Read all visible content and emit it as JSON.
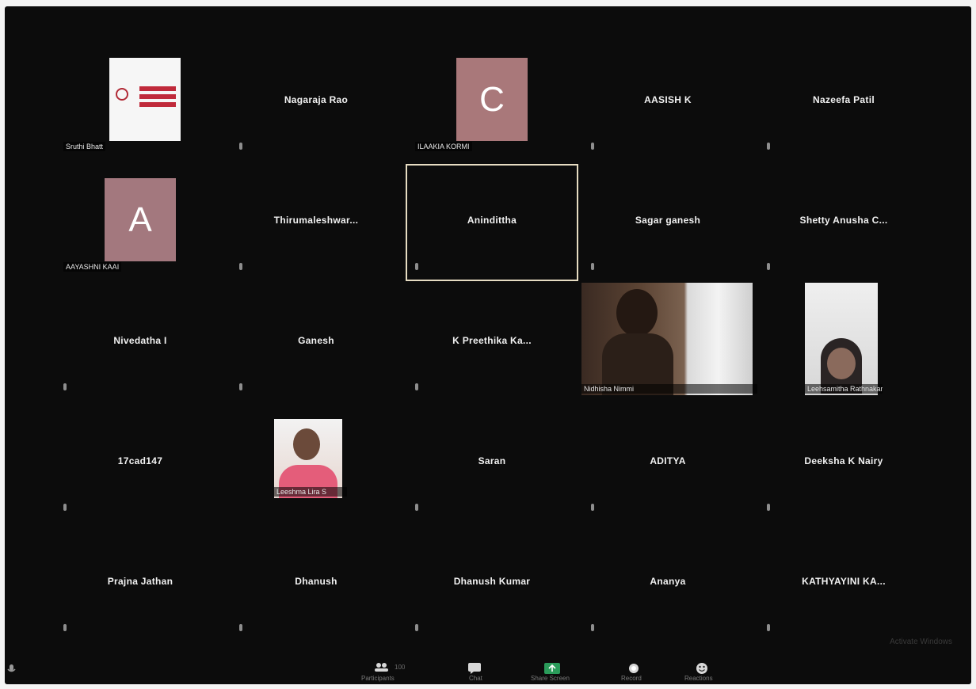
{
  "participants": [
    {
      "name": "",
      "caption": "Sruthi Bhatt",
      "kind": "logo"
    },
    {
      "name": "Nagaraja Rao",
      "caption": "",
      "kind": "name"
    },
    {
      "name": "",
      "caption": "ILAAKIA KORMI",
      "kind": "avatar",
      "letter": "C",
      "color": "#a9787a"
    },
    {
      "name": "AASISH K",
      "caption": "",
      "kind": "name"
    },
    {
      "name": "Nazeefa Patil",
      "caption": "",
      "kind": "name"
    },
    {
      "name": "",
      "caption": "AAYASHNI KAAI",
      "kind": "avatar",
      "letter": "A",
      "color": "#a3787e"
    },
    {
      "name": "Thirumaleshwar...",
      "caption": "",
      "kind": "name"
    },
    {
      "name": "Anindittha",
      "caption": "",
      "kind": "name",
      "active": true
    },
    {
      "name": "Sagar ganesh",
      "caption": "",
      "kind": "name"
    },
    {
      "name": "Shetty Anusha C...",
      "caption": "",
      "kind": "name"
    },
    {
      "name": "Nivedatha I",
      "caption": "",
      "kind": "name"
    },
    {
      "name": "Ganesh",
      "caption": "",
      "kind": "name"
    },
    {
      "name": "K Preethika Ka...",
      "caption": "",
      "kind": "name"
    },
    {
      "name": "",
      "caption": "Nidhisha Nimmi",
      "kind": "video",
      "variant": "man"
    },
    {
      "name": "",
      "caption": "Leehsamitha Rathnakar",
      "kind": "video",
      "variant": "woman"
    },
    {
      "name": "17cad147",
      "caption": "",
      "kind": "name"
    },
    {
      "name": "",
      "caption": "Leeshma Lira S",
      "kind": "video",
      "variant": "photo"
    },
    {
      "name": "Saran",
      "caption": "",
      "kind": "name"
    },
    {
      "name": "ADITYA",
      "caption": "",
      "kind": "name"
    },
    {
      "name": "Deeksha K Nairy",
      "caption": "",
      "kind": "name"
    },
    {
      "name": "Prajna Jathan",
      "caption": "",
      "kind": "name"
    },
    {
      "name": "Dhanush",
      "caption": "",
      "kind": "name"
    },
    {
      "name": "Dhanush Kumar",
      "caption": "",
      "kind": "name"
    },
    {
      "name": "Ananya",
      "caption": "",
      "kind": "name"
    },
    {
      "name": "KATHYAYINI KA...",
      "caption": "",
      "kind": "name"
    }
  ],
  "toolbar": {
    "participants_count": "100",
    "participants_label": "Participants",
    "chat_label": "Chat",
    "share_label": "Share Screen",
    "record_label": "Record",
    "reactions_label": "Reactions"
  },
  "watermark": "Activate Windows"
}
